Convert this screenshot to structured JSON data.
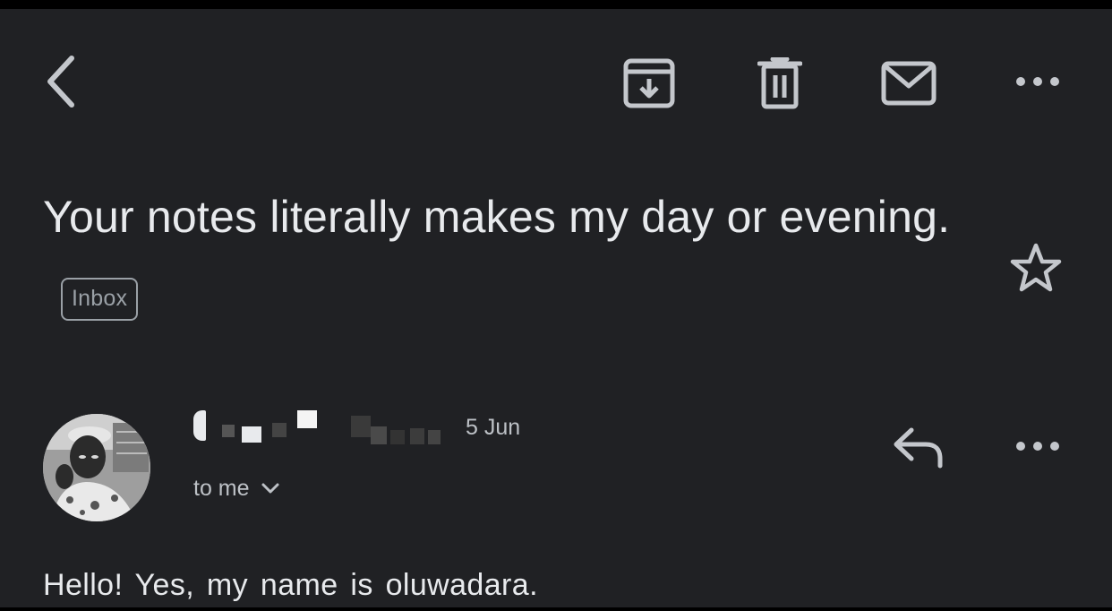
{
  "toolbar": {
    "back": "chevron-left-icon",
    "archive": "archive-icon",
    "delete": "trash-icon",
    "mark_unread": "mail-icon",
    "more": "more-horizontal-icon"
  },
  "email": {
    "subject": "Your notes literally makes my day or evening.",
    "label": "Inbox",
    "starred": false,
    "sender_name": "",
    "sender_name_obscured": true,
    "date": "5 Jun",
    "recipient": "to me",
    "body": "Hello! Yes, my name is oluwadara."
  },
  "colors": {
    "background": "#202124",
    "text_primary": "#e8eaed",
    "text_secondary": "#bdc1c6",
    "icon": "#c4c7cc"
  }
}
